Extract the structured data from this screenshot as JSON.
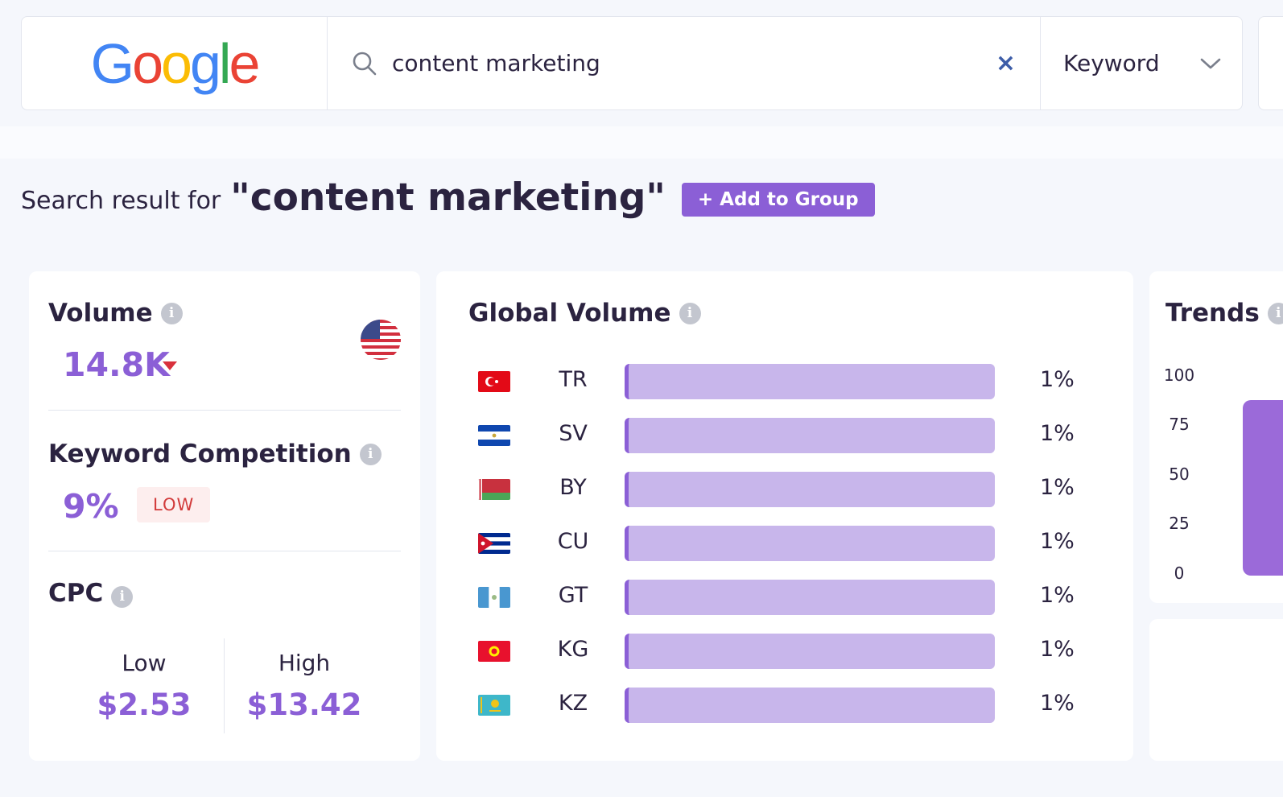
{
  "search": {
    "engine_logo_text": "Google",
    "query": "content marketing",
    "clear_symbol": "×",
    "type_selected": "Keyword"
  },
  "heading": {
    "prefix": "Search result for",
    "query_display": "\"content marketing\"",
    "add_button": "+ Add to Group"
  },
  "volume": {
    "title": "Volume",
    "value": "14.8K",
    "trend": "down",
    "country": "US"
  },
  "competition": {
    "title": "Keyword Competition",
    "value": "9%",
    "level": "LOW"
  },
  "cpc": {
    "title": "CPC",
    "low_label": "Low",
    "low_value": "$2.53",
    "high_label": "High",
    "high_value": "$13.42"
  },
  "global_volume": {
    "title": "Global Volume",
    "rows": [
      {
        "code": "TR",
        "pct": "1%",
        "fill": 1.0
      },
      {
        "code": "SV",
        "pct": "1%",
        "fill": 1.0
      },
      {
        "code": "BY",
        "pct": "1%",
        "fill": 1.0
      },
      {
        "code": "CU",
        "pct": "1%",
        "fill": 1.0
      },
      {
        "code": "GT",
        "pct": "1%",
        "fill": 1.0
      },
      {
        "code": "KG",
        "pct": "1%",
        "fill": 1.0
      },
      {
        "code": "KZ",
        "pct": "1%",
        "fill": 1.0
      }
    ]
  },
  "trends": {
    "title": "Trends",
    "y_ticks": [
      "100",
      "75",
      "50",
      "25",
      "0"
    ]
  },
  "colors": {
    "accent": "#8b5fd6",
    "bar_fill": "#c8b6eb",
    "danger": "#d9313c"
  }
}
